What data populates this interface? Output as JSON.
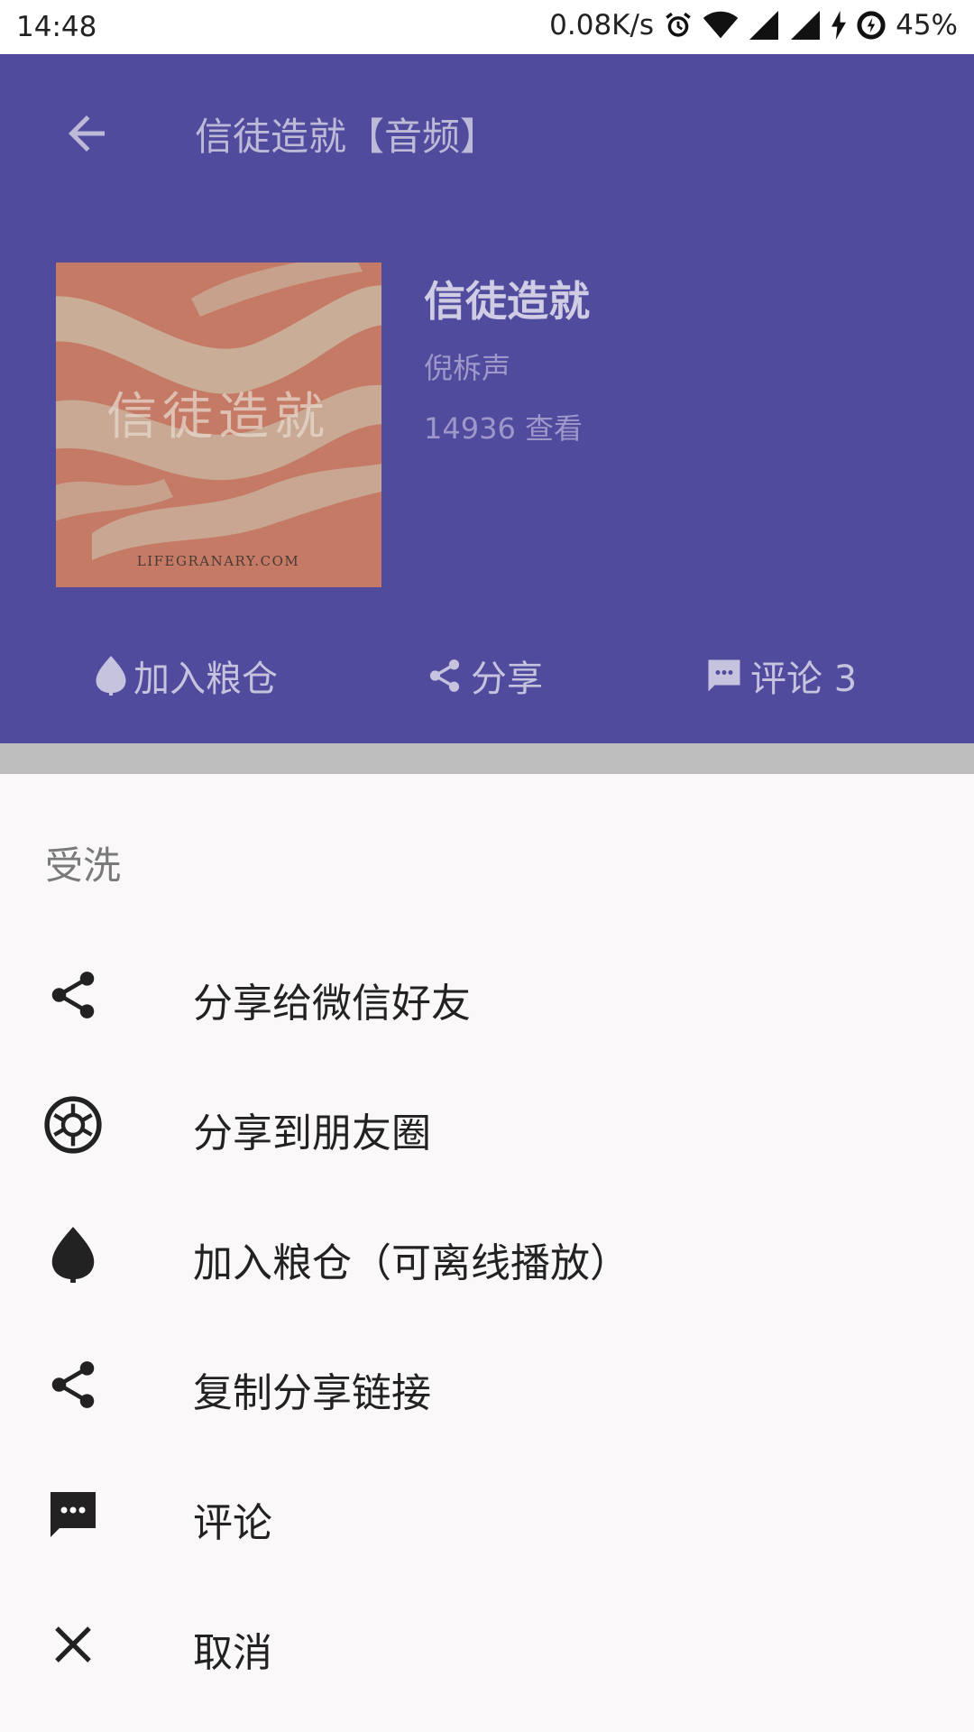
{
  "status_bar": {
    "time": "14:48",
    "speed": "0.08K/s",
    "battery": "45%",
    "icons": [
      "alarm-icon",
      "wifi-icon",
      "signal-icon",
      "signal-icon",
      "charging-icon",
      "battery-icon"
    ]
  },
  "appbar": {
    "title": "信徒造就【音频】",
    "back_icon": "arrow-left-icon"
  },
  "album": {
    "title": "信徒造就",
    "author": "倪柝声",
    "views": "14936 查看",
    "cover_text": "信徒造就",
    "cover_caption": "LIFEGRANARY.COM"
  },
  "actions": [
    {
      "label": "加入粮仓",
      "icon": "seed-icon"
    },
    {
      "label": "分享",
      "icon": "share-icon"
    },
    {
      "label": "评论 3",
      "icon": "comment-icon"
    }
  ],
  "sheet": {
    "title": "受洗",
    "items": [
      {
        "label": "分享给微信好友",
        "icon": "share-icon"
      },
      {
        "label": "分享到朋友圈",
        "icon": "moments-icon"
      },
      {
        "label": "加入粮仓（可离线播放）",
        "icon": "seed-icon"
      },
      {
        "label": "复制分享链接",
        "icon": "share-icon"
      },
      {
        "label": "评论",
        "icon": "comment-icon"
      },
      {
        "label": "取消",
        "icon": "close-icon"
      }
    ]
  },
  "colors": {
    "header_bg": "#514b9e",
    "sheet_bg": "#faf8f8",
    "cover_bg": "#c57a66",
    "cover_stripes": "#c9b29c"
  }
}
